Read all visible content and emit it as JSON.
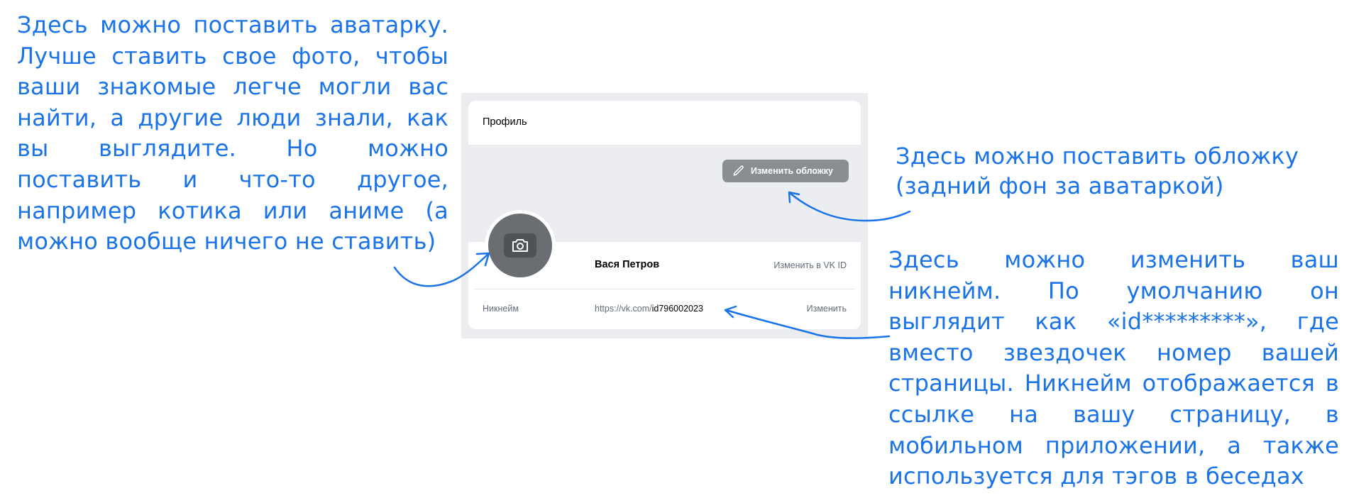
{
  "annotations": {
    "avatar_note": "Здесь можно поставить аватарку. Лучше ставить свое фото, чтобы ваши знакомые легче могли вас найти, а другие люди знали, как вы выглядите. Но можно поставить и что-то другое, например котика или аниме (а можно вообще ничего не ставить)",
    "cover_note": "Здесь можно поставить обложку (задний фон за аватаркой)",
    "nickname_note": "Здесь можно изменить ваш никнейм. По умолчанию он выглядит как «id*********», где вместо звездочек номер вашей страницы. Никнейм отображается в ссылке на вашу страницу, в мобильном приложении, а также используется для тэгов в беседах"
  },
  "profile": {
    "title": "Профиль",
    "change_cover_label": "Изменить обложку",
    "user_name": "Вася Петров",
    "edit_in_vkid_label": "Изменить в VK ID",
    "nickname_label": "Никнейм",
    "nickname_url_prefix": "https://vk.com/",
    "nickname_id": "id796002023",
    "edit_nickname_label": "Изменить"
  },
  "icons": {
    "cover_button_icon": "pencil-icon",
    "avatar_icon": "camera-icon"
  },
  "colors": {
    "annotation_blue": "#1a73e8",
    "panel_gray": "#ebedf0",
    "button_gray": "#8a8d91",
    "avatar_gray": "#6a6d71",
    "secondary_text": "#626d7a"
  }
}
